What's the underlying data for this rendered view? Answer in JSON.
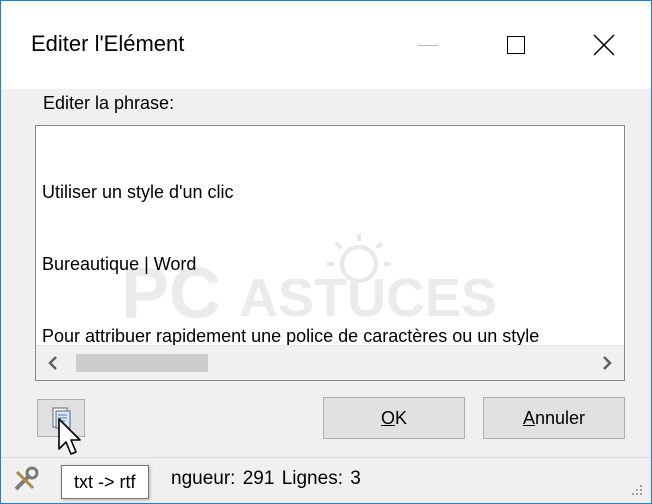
{
  "window": {
    "title": "Editer l'Elément"
  },
  "editor": {
    "label": "Editer la phrase:",
    "lines": [
      "Utiliser un style d'un clic",
      "Bureautique | Word",
      "Pour attribuer rapidement une police de caractères ou un style"
    ]
  },
  "watermark": {
    "text_pc": "PC",
    "text_astuces": "ASTUCES"
  },
  "buttons": {
    "ok_mnemonic": "O",
    "ok_rest": "K",
    "cancel_mnemonic": "A",
    "cancel_rest": "nnuler"
  },
  "tooltip": {
    "text": "txt -> rtf"
  },
  "status": {
    "text": "ngueur: 291  Lignes: 3"
  },
  "icons": {
    "doc_button": "document-convert-icon",
    "status_tools": "tools-icon"
  },
  "colors": {
    "window_border": "#1883d7",
    "button_face": "#e1e1e1",
    "dialog_bg": "#f0f0f0"
  }
}
